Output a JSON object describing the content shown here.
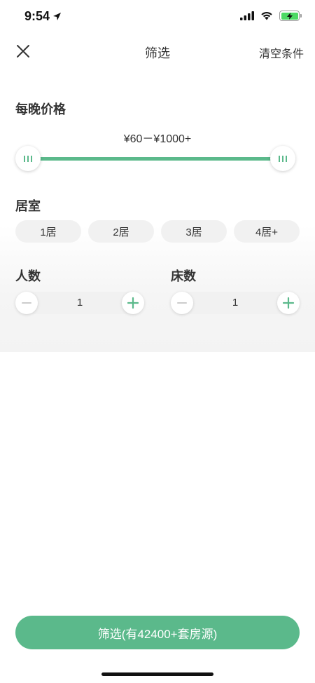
{
  "status_bar": {
    "time": "9:54"
  },
  "nav": {
    "title": "筛选",
    "clear_label": "清空条件"
  },
  "price": {
    "title": "每晚价格",
    "range_label": "¥60－¥1000+",
    "min_fraction": 0,
    "max_fraction": 1
  },
  "rooms": {
    "title": "居室",
    "options": [
      "1居",
      "2居",
      "3居",
      "4居+"
    ]
  },
  "guests": {
    "title": "人数",
    "value": "1"
  },
  "beds": {
    "title": "床数",
    "value": "1"
  },
  "submit": {
    "label": "筛选(有42400+套房源)"
  },
  "colors": {
    "accent": "#5bb98b",
    "chip_bg": "#f1f1f1",
    "disabled": "#cccccc"
  }
}
